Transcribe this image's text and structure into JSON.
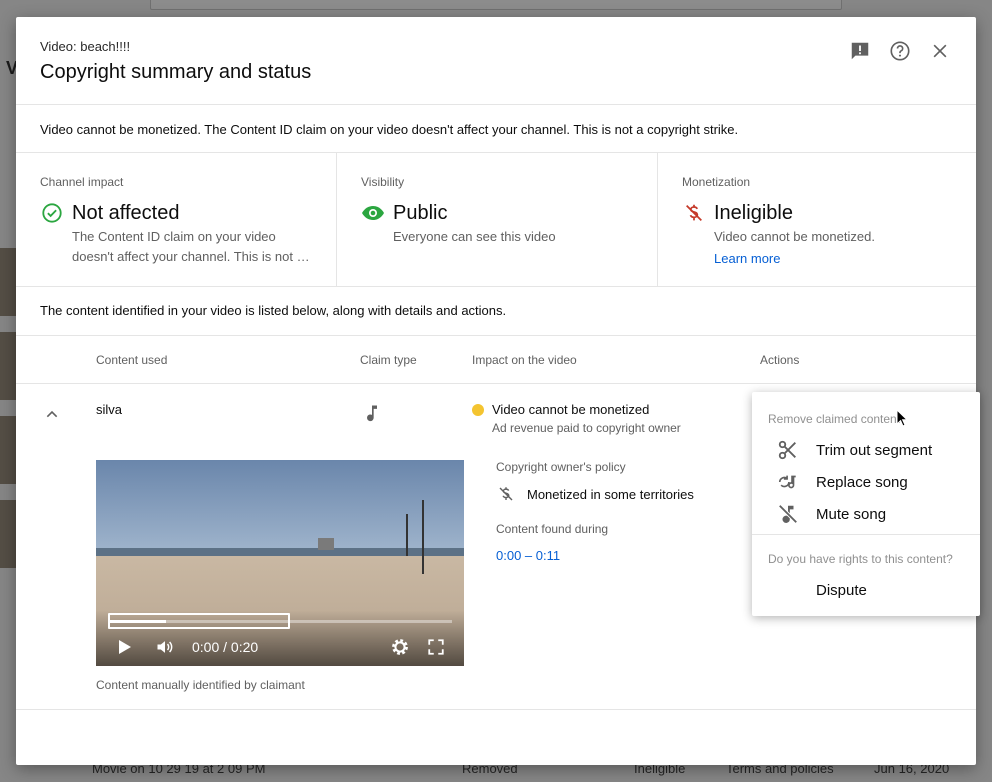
{
  "dialog": {
    "subtitle": "Video: beach!!!!",
    "title": "Copyright summary and status",
    "notice": "Video cannot be monetized. The Content ID claim on your video doesn't affect your channel. This is not a copyright strike.",
    "listed_text": "The content identified in your video is listed below, along with details and actions."
  },
  "impact": {
    "channel": {
      "label": "Channel impact",
      "value": "Not affected",
      "description": "The Content ID claim on your video doesn't affect your channel. This is not a copyright strike.",
      "icon": "check-circle-icon",
      "color": "#2ba640"
    },
    "visibility": {
      "label": "Visibility",
      "value": "Public",
      "description": "Everyone can see this video",
      "icon": "eye-icon",
      "color": "#2ba640"
    },
    "monetization": {
      "label": "Monetization",
      "value": "Ineligible",
      "description": "Video cannot be monetized.",
      "link": "Learn more",
      "icon": "dollar-off-icon",
      "color": "#c53929"
    }
  },
  "table": {
    "headers": {
      "content_used": "Content used",
      "claim_type": "Claim type",
      "impact": "Impact on the video",
      "actions": "Actions"
    },
    "row": {
      "content_name": "silva",
      "claim_icon": "music-note-icon",
      "impact_title": "Video cannot be monetized",
      "impact_sub": "Ad revenue paid to copyright owner",
      "policy_label": "Copyright owner's policy",
      "policy_value": "Monetized in some territories",
      "found_label": "Content found during",
      "found_range": "0:00 – 0:11",
      "identified_by": "Content manually identified by claimant",
      "video_time": "0:00 / 0:20"
    }
  },
  "actions_menu": {
    "header_remove": "Remove claimed content",
    "items": [
      {
        "label": "Trim out segment",
        "icon": "scissors-icon"
      },
      {
        "label": "Replace song",
        "icon": "replace-song-icon"
      },
      {
        "label": "Mute song",
        "icon": "mute-song-icon"
      }
    ],
    "header_rights": "Do you have rights to this content?",
    "dispute": "Dispute"
  },
  "background": {
    "letter": "V",
    "row_title": "Movie on 10 29 19 at 2 09 PM",
    "row_status": "Removed",
    "row_monetization": "Ineligible",
    "row_restriction": "Terms and policies",
    "row_date": "Jun 16, 2020"
  }
}
